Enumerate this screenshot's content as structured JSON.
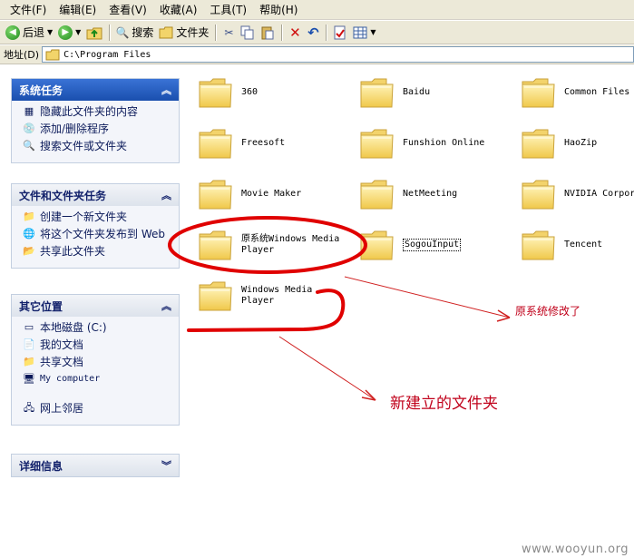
{
  "menu": [
    "文件(F)",
    "编辑(E)",
    "查看(V)",
    "收藏(A)",
    "工具(T)",
    "帮助(H)"
  ],
  "toolbar": {
    "back_label": "后退",
    "search_label": "搜索",
    "folders_label": "文件夹"
  },
  "address": {
    "label": "地址(D)",
    "path": "C:\\Program Files"
  },
  "panels": {
    "system_tasks": {
      "title": "系统任务",
      "items": [
        "隐藏此文件夹的内容",
        "添加/删除程序",
        "搜索文件或文件夹"
      ]
    },
    "file_tasks": {
      "title": "文件和文件夹任务",
      "items": [
        "创建一个新文件夹",
        "将这个文件夹发布到 Web",
        "共享此文件夹"
      ]
    },
    "other_places": {
      "title": "其它位置",
      "items": [
        "本地磁盘 (C:)",
        "我的文档",
        "共享文档",
        "My computer",
        "网上邻居"
      ]
    },
    "details": {
      "title": "详细信息"
    }
  },
  "folders": [
    "360",
    "Baidu",
    "Common Files",
    "Freesoft",
    "Funshion Online",
    "HaoZip",
    "Movie Maker",
    "NetMeeting",
    "NVIDIA Corpor",
    "原系统Windows Media Player",
    "SogouInput",
    "Tencent",
    "Windows Media Player"
  ],
  "annotations": {
    "modified_note": "原系统修改了",
    "new_folder_note": "新建立的文件夹"
  },
  "watermark": "www.wooyun.org",
  "colors": {
    "annotation_red": "#e00000",
    "folder_yellow": "#f7d96b",
    "panel_header_blue": "#2a5fc4"
  }
}
